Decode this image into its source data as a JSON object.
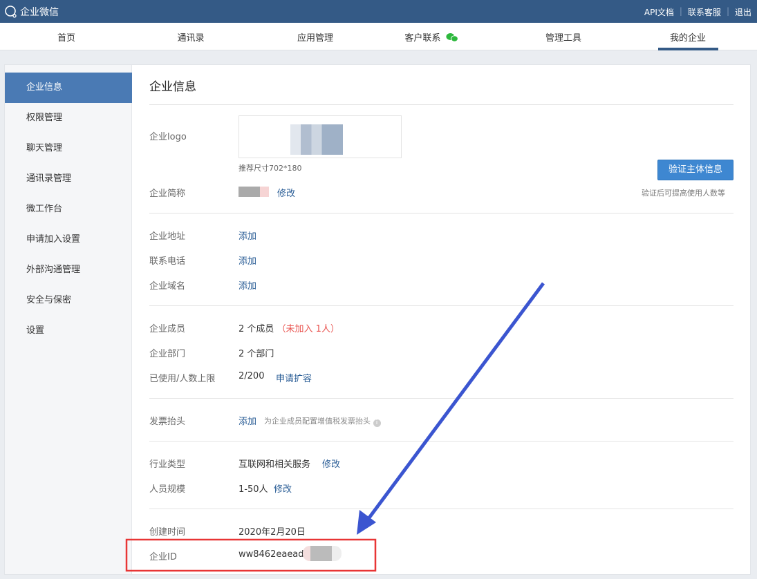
{
  "header": {
    "app_name": "企业微信",
    "links": [
      "API文档",
      "联系客服",
      "退出"
    ]
  },
  "nav": {
    "tabs": [
      "首页",
      "通讯录",
      "应用管理",
      "客户联系",
      "管理工具",
      "我的企业"
    ],
    "active": "我的企业"
  },
  "sidebar": {
    "items": [
      "企业信息",
      "权限管理",
      "聊天管理",
      "通讯录管理",
      "微工作台",
      "申请加入设置",
      "外部沟通管理",
      "安全与保密",
      "设置"
    ]
  },
  "main": {
    "title": "企业信息",
    "logo": {
      "label": "企业logo",
      "hint": "推荐尺寸702*180"
    },
    "verify": {
      "button": "验证主体信息",
      "hint": "验证后可提高使用人数等"
    },
    "short_name": {
      "label": "企业简称",
      "action": "修改"
    },
    "address": {
      "label": "企业地址",
      "action": "添加"
    },
    "phone": {
      "label": "联系电话",
      "action": "添加"
    },
    "domain": {
      "label": "企业域名",
      "action": "添加"
    },
    "members": {
      "label": "企业成员",
      "value": "2 个成员",
      "note": "（未加入 1人）"
    },
    "departments": {
      "label": "企业部门",
      "value": "2 个部门"
    },
    "limit": {
      "label": "已使用/人数上限",
      "value": "2/200",
      "action": "申请扩容"
    },
    "invoice": {
      "label": "发票抬头",
      "action": "添加",
      "hint": "为企业成员配置增值税发票抬头"
    },
    "industry": {
      "label": "行业类型",
      "value": "互联网和相关服务",
      "action": "修改"
    },
    "size": {
      "label": "人员规模",
      "value": "1-50人",
      "action": "修改"
    },
    "created": {
      "label": "创建时间",
      "value": "2020年2月20日"
    },
    "corp_id": {
      "label": "企业ID",
      "value": "ww8462eaeadf"
    }
  },
  "colors": {
    "header": "#345a86",
    "accent": "#4a7ab4",
    "button": "#3e87d1",
    "warn": "#e9534f",
    "annotation_arrow": "#3b55d0",
    "annotation_box": "#e83535"
  }
}
